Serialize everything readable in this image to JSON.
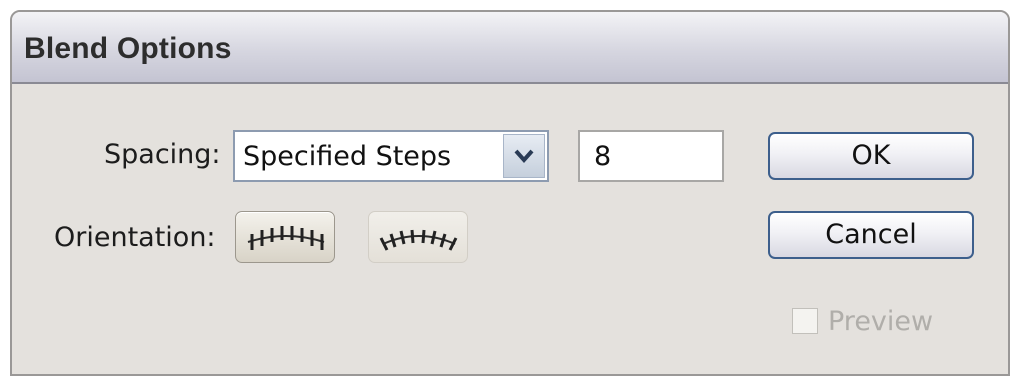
{
  "dialog": {
    "title": "Blend Options"
  },
  "spacing": {
    "label": "Spacing:",
    "selected": "Specified Steps",
    "steps_value": "8"
  },
  "orientation": {
    "label": "Orientation:",
    "options": [
      {
        "icon": "align-to-page-icon",
        "selected": true
      },
      {
        "icon": "align-to-path-icon",
        "selected": false
      }
    ]
  },
  "buttons": {
    "ok": "OK",
    "cancel": "Cancel"
  },
  "preview": {
    "label": "Preview",
    "checked": false,
    "enabled": false
  }
}
